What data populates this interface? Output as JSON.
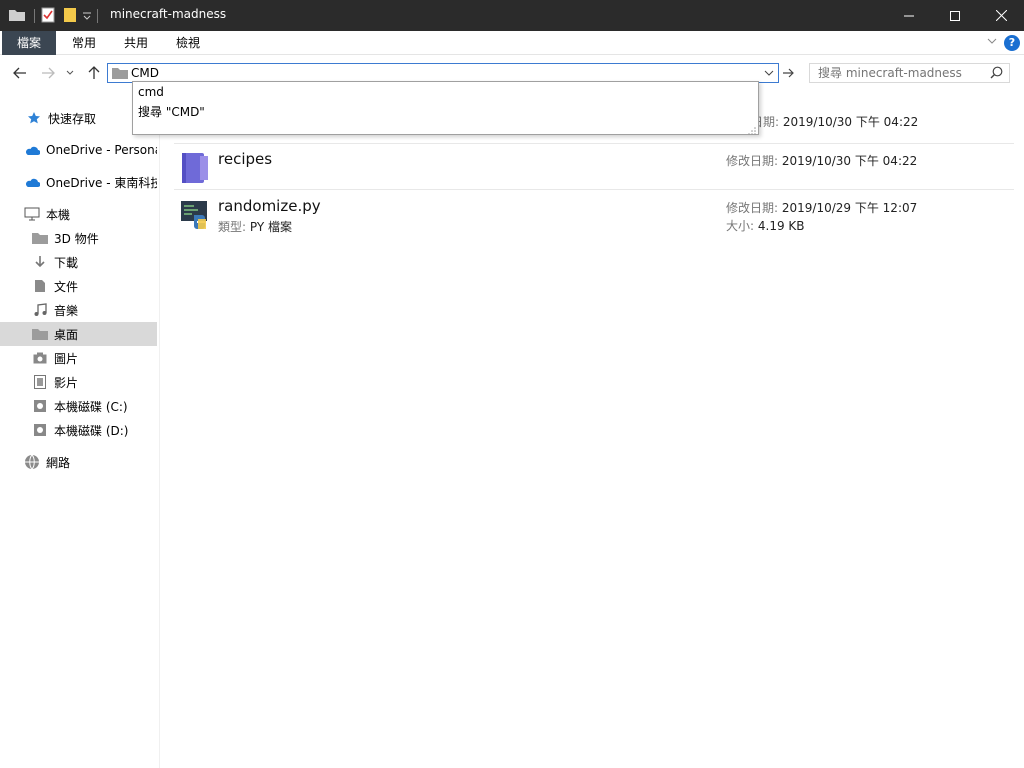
{
  "window": {
    "title": "minecraft-madness",
    "minimize_glyph": "—",
    "maximize_glyph": "☐",
    "close_glyph": "✕"
  },
  "ribbon": {
    "tabs": [
      "檔案",
      "常用",
      "共用",
      "檢視"
    ],
    "help_glyph": "?"
  },
  "address": {
    "value": "CMD"
  },
  "search": {
    "placeholder": "搜尋 minecraft-madness"
  },
  "suggestions": [
    "cmd",
    "搜尋 \"CMD\""
  ],
  "sidebar": {
    "items": [
      {
        "label": "快速存取",
        "icon": "star-icon"
      },
      {
        "label": "OneDrive - Personal",
        "icon": "cloud-icon"
      },
      {
        "label": "OneDrive - 東南科技",
        "icon": "cloud-icon"
      },
      {
        "label": "本機",
        "icon": "computer-icon"
      },
      {
        "label": "3D 物件",
        "icon": "folder-3d-icon"
      },
      {
        "label": "下載",
        "icon": "download-icon"
      },
      {
        "label": "文件",
        "icon": "document-icon"
      },
      {
        "label": "音樂",
        "icon": "music-icon"
      },
      {
        "label": "桌面",
        "icon": "desktop-icon"
      },
      {
        "label": "圖片",
        "icon": "camera-icon"
      },
      {
        "label": "影片",
        "icon": "film-icon"
      },
      {
        "label": "本機磁碟 (C:)",
        "icon": "drive-icon"
      },
      {
        "label": "本機磁碟 (D:)",
        "icon": "drive-icon"
      },
      {
        "label": "網路",
        "icon": "network-icon"
      }
    ]
  },
  "files": [
    {
      "name": "",
      "modified_label": "日期:",
      "modified": "2019/10/30 下午 04:22"
    },
    {
      "name": "recipes",
      "modified_label": "修改日期:",
      "modified": "2019/10/30 下午 04:22",
      "icon": "notebook-icon"
    },
    {
      "name": "randomize.py",
      "type_label": "類型:",
      "type": "PY 檔案",
      "modified_label": "修改日期:",
      "modified": "2019/10/29 下午 12:07",
      "size_label": "大小:",
      "size": "4.19 KB",
      "icon": "python-file-icon"
    }
  ],
  "colors": {
    "titlebar": "#2b2b2b",
    "accent": "#3d7bd1",
    "selected": "#d9d9d9",
    "onedrive": "#1f7ad6",
    "notebook": "#7b6fd6"
  }
}
